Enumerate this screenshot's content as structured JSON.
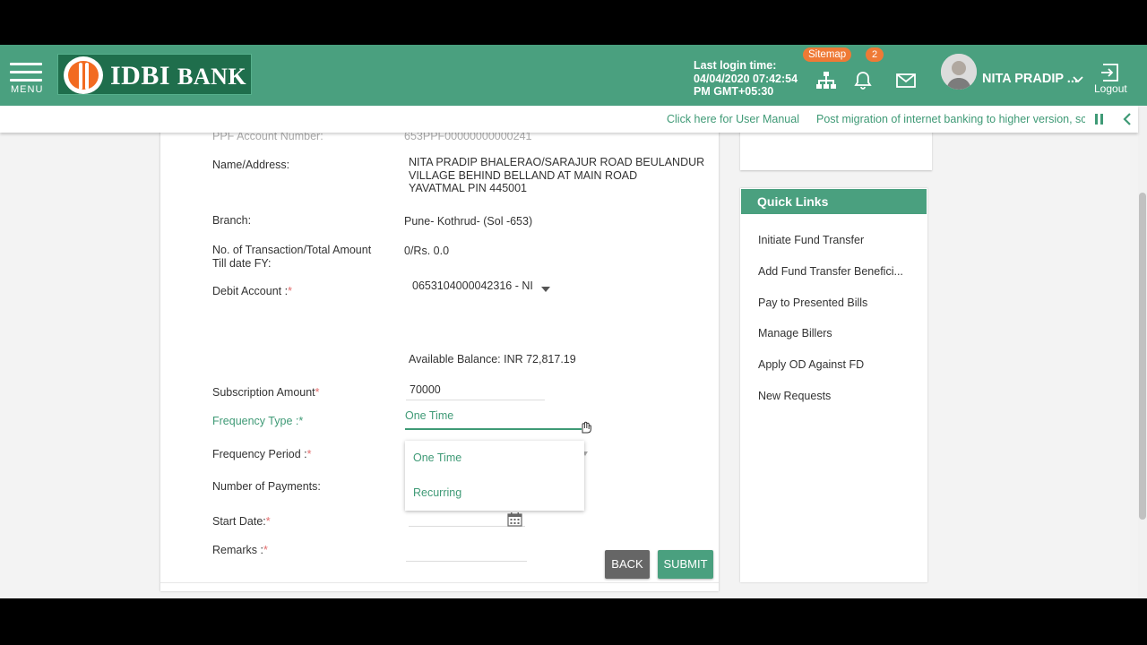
{
  "header": {
    "menu_label": "MENU",
    "brand_main": "IDBI",
    "brand_sub": "BANK",
    "last_login_label": "Last login time:",
    "last_login_line1": "04/04/2020 07:42:54",
    "last_login_line2": "PM GMT+05:30",
    "sitemap_label": "Sitemap",
    "notification_count": "2",
    "user_name": "NITA PRADIP ...",
    "logout_label": "Logout"
  },
  "ticker": {
    "manual_link": "Click here for User Manual",
    "message": "Post migration of internet banking to higher version, sc"
  },
  "form": {
    "ppf_label": "PPF Account Number:",
    "ppf_value": "653PPF00000000000241",
    "name_label": "Name/Address:",
    "name_line1": "NITA PRADIP BHALERAO/SARAJUR ROAD BEULANDUR",
    "name_line2": "VILLAGE BEHIND BELLAND AT MAIN ROAD",
    "name_line3": "YAVATMAL PIN 445001",
    "branch_label": "Branch:",
    "branch_value": "Pune- Kothrud- (Sol -653)",
    "txn_label_line1": "No. of Transaction/Total Amount",
    "txn_label_line2": "Till date FY:",
    "txn_value": "0/Rs. 0.0",
    "debit_label": "Debit Account :",
    "debit_value": "0653104000042316 - NI",
    "available_balance": "Available Balance: INR 72,817.19",
    "subscription_label": "Subscription Amount",
    "subscription_value": "70000",
    "frequency_type_label": "Frequency Type :",
    "frequency_type_value": "One Time",
    "frequency_options": [
      "One Time",
      "Recurring"
    ],
    "frequency_period_label": "Frequency Period :",
    "num_payments_label": "Number of Payments:",
    "start_date_label": "Start Date:",
    "remarks_label": "Remarks :",
    "required_mark": "*",
    "back_label": "BACK",
    "submit_label": "SUBMIT"
  },
  "quick_links": {
    "title": "Quick Links",
    "items": [
      "Initiate Fund Transfer",
      "Add Fund Transfer Benefici...",
      "Pay to Presented Bills",
      "Manage Billers",
      "Apply OD Against FD",
      "New Requests"
    ]
  },
  "colors": {
    "brand_green": "#4aa07f",
    "accent_orange": "#ef7a36",
    "link_green": "#3f9a76"
  }
}
